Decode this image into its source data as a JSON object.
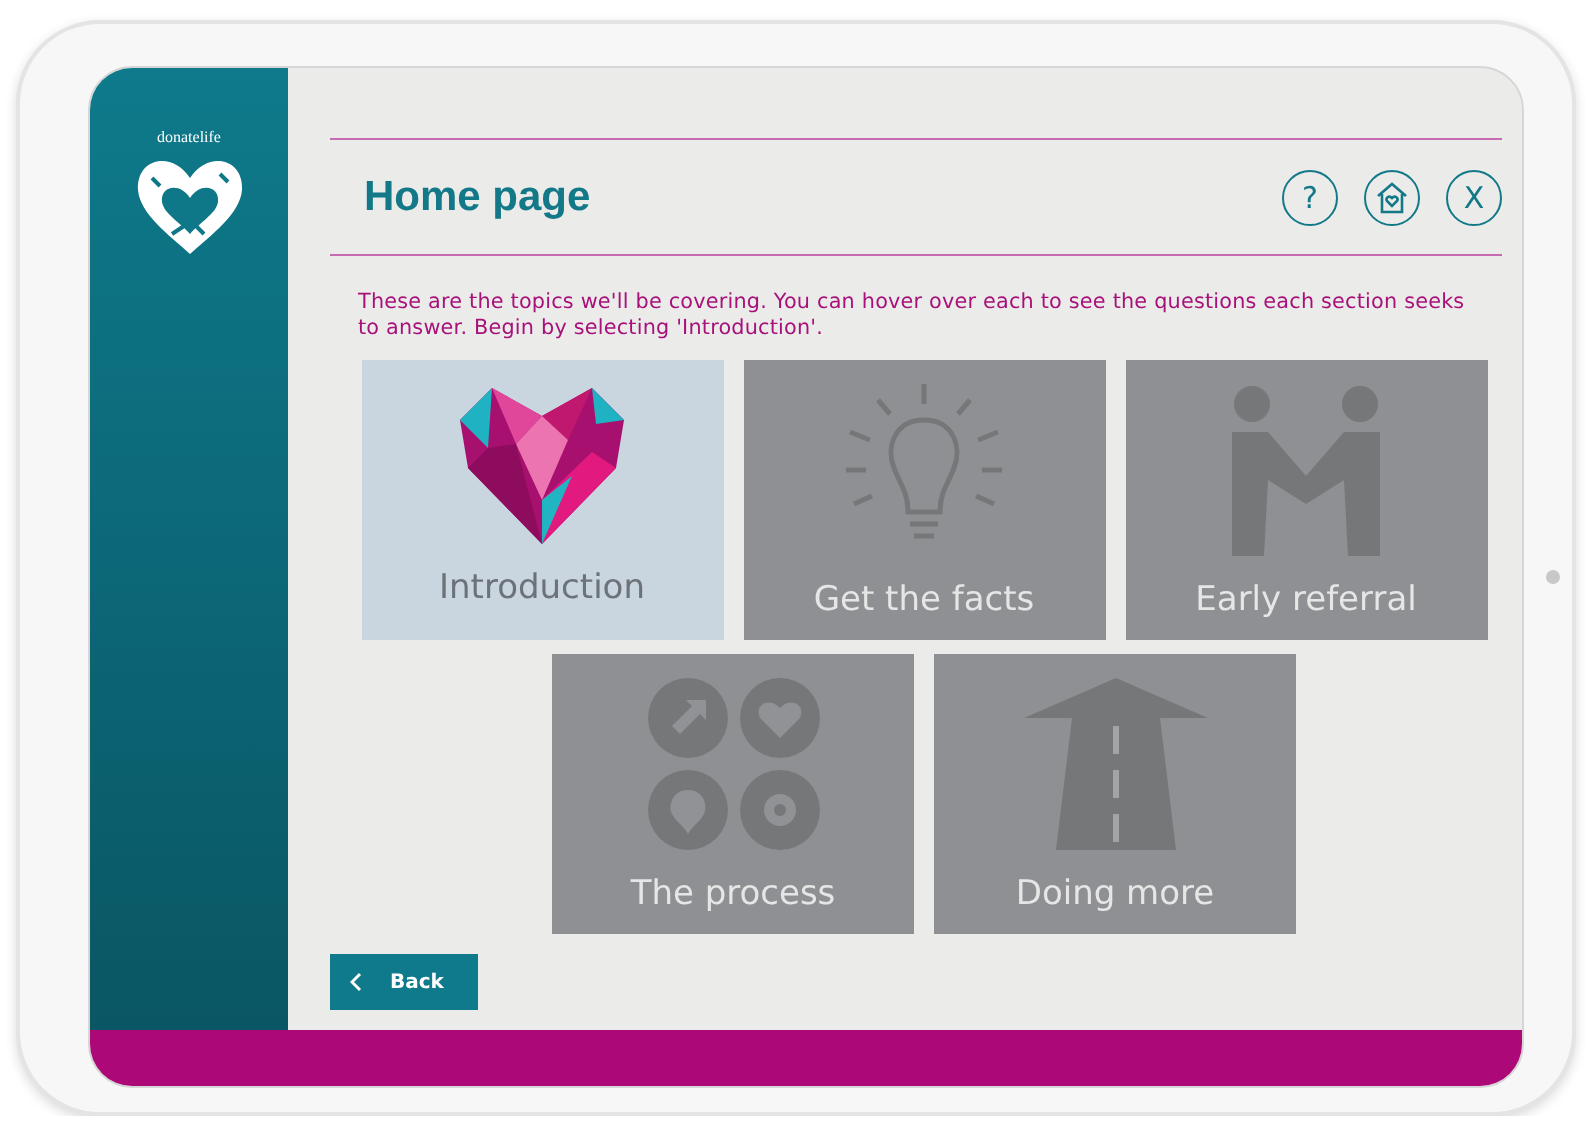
{
  "sidebar": {
    "logo_text": "donatelife"
  },
  "header": {
    "title": "Home page",
    "buttons": [
      {
        "kind": "help",
        "label": "?"
      },
      {
        "kind": "home"
      },
      {
        "kind": "close",
        "label": "X"
      }
    ]
  },
  "intro": "These are the topics we'll be covering. You can hover over each to see the questions each section seeks to answer. Begin by selecting 'Introduction'.",
  "topics": [
    {
      "label": "Introduction",
      "kind": "heart",
      "selected": true
    },
    {
      "label": "Get the facts",
      "kind": "bulb",
      "selected": false
    },
    {
      "label": "Early referral",
      "kind": "people",
      "selected": false
    },
    {
      "label": "The process",
      "kind": "process",
      "selected": false
    },
    {
      "label": "Doing more",
      "kind": "road",
      "selected": false
    }
  ],
  "back_button": {
    "label": "Back"
  }
}
